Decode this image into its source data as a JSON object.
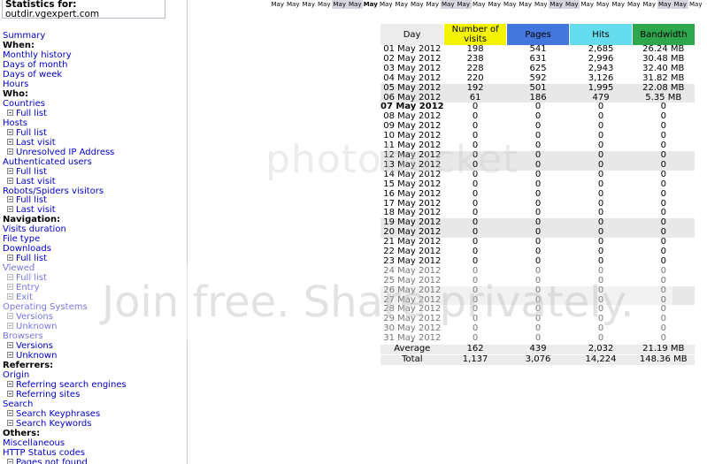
{
  "header": {
    "stats_label": "Statistics for:",
    "site": "outdir.vgexpert.com"
  },
  "menu": [
    {
      "text": "Summary",
      "kind": "link"
    },
    {
      "text": "When:",
      "kind": "head"
    },
    {
      "text": "Monthly history",
      "kind": "link"
    },
    {
      "text": "Days of month",
      "kind": "link"
    },
    {
      "text": "Days of week",
      "kind": "link"
    },
    {
      "text": "Hours",
      "kind": "link"
    },
    {
      "text": "Who:",
      "kind": "head"
    },
    {
      "text": "Countries",
      "kind": "link"
    },
    {
      "text": "Full list",
      "kind": "sub"
    },
    {
      "text": "Hosts",
      "kind": "link"
    },
    {
      "text": "Full list",
      "kind": "sub"
    },
    {
      "text": "Last visit",
      "kind": "sub"
    },
    {
      "text": "Unresolved IP Address",
      "kind": "sub"
    },
    {
      "text": "Authenticated users",
      "kind": "link"
    },
    {
      "text": "Full list",
      "kind": "sub"
    },
    {
      "text": "Last visit",
      "kind": "sub"
    },
    {
      "text": "Robots/Spiders visitors",
      "kind": "link"
    },
    {
      "text": "Full list",
      "kind": "sub"
    },
    {
      "text": "Last visit",
      "kind": "sub"
    },
    {
      "text": "Navigation:",
      "kind": "head"
    },
    {
      "text": "Visits duration",
      "kind": "link"
    },
    {
      "text": "File type",
      "kind": "link"
    },
    {
      "text": "Downloads",
      "kind": "link"
    },
    {
      "text": "Full list",
      "kind": "sub"
    },
    {
      "text": "Viewed",
      "kind": "link"
    },
    {
      "text": "Full list",
      "kind": "sub"
    },
    {
      "text": "Entry",
      "kind": "sub"
    },
    {
      "text": "Exit",
      "kind": "sub"
    },
    {
      "text": "Operating Systems",
      "kind": "link"
    },
    {
      "text": "Versions",
      "kind": "sub"
    },
    {
      "text": "Unknown",
      "kind": "sub"
    },
    {
      "text": "Browsers",
      "kind": "link"
    },
    {
      "text": "Versions",
      "kind": "sub"
    },
    {
      "text": "Unknown",
      "kind": "sub"
    },
    {
      "text": "Referrers:",
      "kind": "head"
    },
    {
      "text": "Origin",
      "kind": "link"
    },
    {
      "text": "Referring search engines",
      "kind": "sub"
    },
    {
      "text": "Referring sites",
      "kind": "sub"
    },
    {
      "text": "Search",
      "kind": "link"
    },
    {
      "text": "Search Keyphrases",
      "kind": "sub"
    },
    {
      "text": "Search Keywords",
      "kind": "sub"
    },
    {
      "text": "Others:",
      "kind": "head"
    },
    {
      "text": "Miscellaneous",
      "kind": "link"
    },
    {
      "text": "HTTP Status codes",
      "kind": "link"
    },
    {
      "text": "Pages not found",
      "kind": "sub"
    }
  ],
  "month_bar": [
    {
      "label": "May",
      "highlight": false,
      "current": false
    },
    {
      "label": "May",
      "highlight": false,
      "current": false
    },
    {
      "label": "May",
      "highlight": false,
      "current": false
    },
    {
      "label": "May",
      "highlight": false,
      "current": false
    },
    {
      "label": "May",
      "highlight": true,
      "current": false
    },
    {
      "label": "May",
      "highlight": true,
      "current": false
    },
    {
      "label": "May",
      "highlight": false,
      "current": true
    },
    {
      "label": "May",
      "highlight": false,
      "current": false
    },
    {
      "label": "May",
      "highlight": false,
      "current": false
    },
    {
      "label": "May",
      "highlight": false,
      "current": false
    },
    {
      "label": "May",
      "highlight": false,
      "current": false
    },
    {
      "label": "May",
      "highlight": true,
      "current": false
    },
    {
      "label": "May",
      "highlight": true,
      "current": false
    },
    {
      "label": "May",
      "highlight": false,
      "current": false
    },
    {
      "label": "May",
      "highlight": false,
      "current": false
    },
    {
      "label": "May",
      "highlight": false,
      "current": false
    },
    {
      "label": "May",
      "highlight": false,
      "current": false
    },
    {
      "label": "May",
      "highlight": false,
      "current": false
    },
    {
      "label": "May",
      "highlight": true,
      "current": false
    },
    {
      "label": "May",
      "highlight": true,
      "current": false
    },
    {
      "label": "May",
      "highlight": false,
      "current": false
    },
    {
      "label": "May",
      "highlight": false,
      "current": false
    },
    {
      "label": "May",
      "highlight": false,
      "current": false
    },
    {
      "label": "May",
      "highlight": false,
      "current": false
    },
    {
      "label": "May",
      "highlight": false,
      "current": false
    },
    {
      "label": "May",
      "highlight": true,
      "current": false
    },
    {
      "label": "May",
      "highlight": true,
      "current": false
    },
    {
      "label": "May",
      "highlight": false,
      "current": false
    }
  ],
  "table": {
    "headers": {
      "day": "Day",
      "visits_line1": "Number of",
      "visits_line2": "visits",
      "pages": "Pages",
      "hits": "Hits",
      "bandwidth": "Bandwidth"
    },
    "colors": {
      "visits": "#f4f400",
      "pages": "#4477dd",
      "hits": "#66ddee",
      "bandwidth": "#2ea64e"
    },
    "rows": [
      {
        "day": "01 May 2012",
        "visits": "198",
        "pages": "541",
        "hits": "2,685",
        "bandwidth": "26.24 MB",
        "weekend": false,
        "today": false
      },
      {
        "day": "02 May 2012",
        "visits": "238",
        "pages": "631",
        "hits": "2,996",
        "bandwidth": "30.48 MB",
        "weekend": false,
        "today": false
      },
      {
        "day": "03 May 2012",
        "visits": "228",
        "pages": "625",
        "hits": "2,943",
        "bandwidth": "32.40 MB",
        "weekend": false,
        "today": false
      },
      {
        "day": "04 May 2012",
        "visits": "220",
        "pages": "592",
        "hits": "3,126",
        "bandwidth": "31.82 MB",
        "weekend": false,
        "today": false
      },
      {
        "day": "05 May 2012",
        "visits": "192",
        "pages": "501",
        "hits": "1,995",
        "bandwidth": "22.08 MB",
        "weekend": true,
        "today": false
      },
      {
        "day": "06 May 2012",
        "visits": "61",
        "pages": "186",
        "hits": "479",
        "bandwidth": "5.35 MB",
        "weekend": true,
        "today": false
      },
      {
        "day": "07 May 2012",
        "visits": "0",
        "pages": "0",
        "hits": "0",
        "bandwidth": "0",
        "weekend": false,
        "today": true
      },
      {
        "day": "08 May 2012",
        "visits": "0",
        "pages": "0",
        "hits": "0",
        "bandwidth": "0",
        "weekend": false,
        "today": false
      },
      {
        "day": "09 May 2012",
        "visits": "0",
        "pages": "0",
        "hits": "0",
        "bandwidth": "0",
        "weekend": false,
        "today": false
      },
      {
        "day": "10 May 2012",
        "visits": "0",
        "pages": "0",
        "hits": "0",
        "bandwidth": "0",
        "weekend": false,
        "today": false
      },
      {
        "day": "11 May 2012",
        "visits": "0",
        "pages": "0",
        "hits": "0",
        "bandwidth": "0",
        "weekend": false,
        "today": false
      },
      {
        "day": "12 May 2012",
        "visits": "0",
        "pages": "0",
        "hits": "0",
        "bandwidth": "0",
        "weekend": true,
        "today": false
      },
      {
        "day": "13 May 2012",
        "visits": "0",
        "pages": "0",
        "hits": "0",
        "bandwidth": "0",
        "weekend": true,
        "today": false
      },
      {
        "day": "14 May 2012",
        "visits": "0",
        "pages": "0",
        "hits": "0",
        "bandwidth": "0",
        "weekend": false,
        "today": false
      },
      {
        "day": "15 May 2012",
        "visits": "0",
        "pages": "0",
        "hits": "0",
        "bandwidth": "0",
        "weekend": false,
        "today": false
      },
      {
        "day": "16 May 2012",
        "visits": "0",
        "pages": "0",
        "hits": "0",
        "bandwidth": "0",
        "weekend": false,
        "today": false
      },
      {
        "day": "17 May 2012",
        "visits": "0",
        "pages": "0",
        "hits": "0",
        "bandwidth": "0",
        "weekend": false,
        "today": false
      },
      {
        "day": "18 May 2012",
        "visits": "0",
        "pages": "0",
        "hits": "0",
        "bandwidth": "0",
        "weekend": false,
        "today": false
      },
      {
        "day": "19 May 2012",
        "visits": "0",
        "pages": "0",
        "hits": "0",
        "bandwidth": "0",
        "weekend": true,
        "today": false
      },
      {
        "day": "20 May 2012",
        "visits": "0",
        "pages": "0",
        "hits": "0",
        "bandwidth": "0",
        "weekend": true,
        "today": false
      },
      {
        "day": "21 May 2012",
        "visits": "0",
        "pages": "0",
        "hits": "0",
        "bandwidth": "0",
        "weekend": false,
        "today": false
      },
      {
        "day": "22 May 2012",
        "visits": "0",
        "pages": "0",
        "hits": "0",
        "bandwidth": "0",
        "weekend": false,
        "today": false
      },
      {
        "day": "23 May 2012",
        "visits": "0",
        "pages": "0",
        "hits": "0",
        "bandwidth": "0",
        "weekend": false,
        "today": false
      },
      {
        "day": "24 May 2012",
        "visits": "0",
        "pages": "0",
        "hits": "0",
        "bandwidth": "0",
        "weekend": false,
        "today": false
      },
      {
        "day": "25 May 2012",
        "visits": "0",
        "pages": "0",
        "hits": "0",
        "bandwidth": "0",
        "weekend": false,
        "today": false
      },
      {
        "day": "26 May 2012",
        "visits": "0",
        "pages": "0",
        "hits": "0",
        "bandwidth": "0",
        "weekend": true,
        "today": false
      },
      {
        "day": "27 May 2012",
        "visits": "0",
        "pages": "0",
        "hits": "0",
        "bandwidth": "0",
        "weekend": true,
        "today": false
      },
      {
        "day": "28 May 2012",
        "visits": "0",
        "pages": "0",
        "hits": "0",
        "bandwidth": "0",
        "weekend": false,
        "today": false
      },
      {
        "day": "29 May 2012",
        "visits": "0",
        "pages": "0",
        "hits": "0",
        "bandwidth": "0",
        "weekend": false,
        "today": false
      },
      {
        "day": "30 May 2012",
        "visits": "0",
        "pages": "0",
        "hits": "0",
        "bandwidth": "0",
        "weekend": false,
        "today": false
      },
      {
        "day": "31 May 2012",
        "visits": "0",
        "pages": "0",
        "hits": "0",
        "bandwidth": "0",
        "weekend": false,
        "today": false
      }
    ],
    "summary": [
      {
        "day": "Average",
        "visits": "162",
        "pages": "439",
        "hits": "2,032",
        "bandwidth": "21.19 MB"
      },
      {
        "day": "Total",
        "visits": "1,137",
        "pages": "3,076",
        "hits": "14,224",
        "bandwidth": "148.36 MB"
      }
    ]
  },
  "watermark": {
    "top": "photobucket",
    "bottom": "Join free. Share privately."
  }
}
